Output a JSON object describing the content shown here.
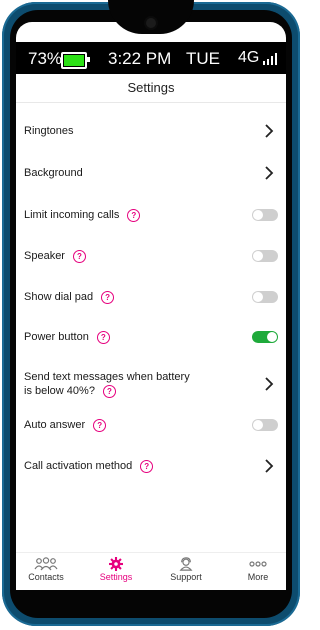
{
  "status": {
    "battery_percent": "73%",
    "battery_level": 1.0,
    "time": "3:22 PM",
    "day": "TUE",
    "network": "4G"
  },
  "header": {
    "title": "Settings"
  },
  "settings": [
    {
      "label": "Ringtones",
      "control": "chevron"
    },
    {
      "label": "Background",
      "control": "chevron"
    },
    {
      "label": "Limit incoming calls",
      "help": true,
      "control": "toggle",
      "on": false
    },
    {
      "label": "Speaker",
      "help": true,
      "control": "toggle",
      "on": false
    },
    {
      "label": "Show dial pad",
      "help": true,
      "control": "toggle",
      "on": false
    },
    {
      "label": "Power button",
      "help": true,
      "control": "toggle",
      "on": true
    },
    {
      "label": "Send text messages when battery is below 40%?",
      "help": true,
      "control": "chevron"
    },
    {
      "label": "Auto answer",
      "help": true,
      "control": "toggle",
      "on": false
    },
    {
      "label": "Call activation method",
      "help": true,
      "control": "chevron"
    }
  ],
  "help_symbol": "?",
  "nav": {
    "contacts": "Contacts",
    "settings": "Settings",
    "support": "Support",
    "more": "More"
  },
  "colors": {
    "accent": "#e6007e",
    "toggle_on": "#1faa3b",
    "toggle_off": "#cfcfcf"
  }
}
